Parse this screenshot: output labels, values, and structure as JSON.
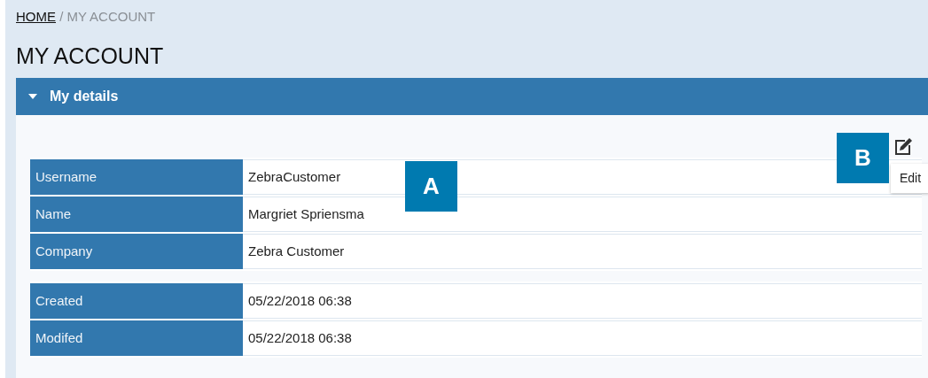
{
  "breadcrumb": [
    {
      "label": "HOME",
      "kind": "link"
    },
    {
      "label": "MY ACCOUNT",
      "kind": "current"
    }
  ],
  "breadcrumb_separator": "/",
  "title": "MY ACCOUNT",
  "panel": {
    "title": "My details",
    "expanded": true
  },
  "edit_tooltip": "Edit",
  "groups": [
    {
      "rows": [
        {
          "label": "Username",
          "value": "ZebraCustomer"
        },
        {
          "label": "Name",
          "value": "Margriet Spriensma"
        },
        {
          "label": "Company",
          "value": "Zebra Customer"
        }
      ]
    },
    {
      "rows": [
        {
          "label": "Created",
          "value": "05/22/2018 06:38"
        },
        {
          "label": "Modifed",
          "value": "05/22/2018 06:38"
        }
      ]
    }
  ],
  "callouts": [
    {
      "label": "A"
    },
    {
      "label": "B"
    }
  ]
}
